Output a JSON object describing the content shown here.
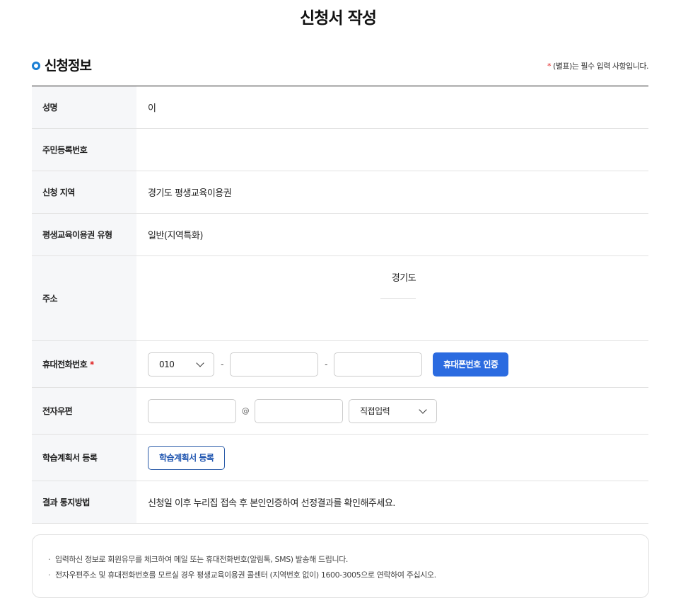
{
  "page_title": "신청서 작성",
  "section": {
    "title": "신청정보",
    "required_star": "*",
    "required_note": "(별표)는 필수 입력 사항입니다."
  },
  "rows": {
    "name": {
      "label": "성명",
      "value": "이"
    },
    "resident_number": {
      "label": "주민등록번호",
      "value": ""
    },
    "region": {
      "label": "신청 지역",
      "value": "경기도 평생교육이용권"
    },
    "voucher_type": {
      "label": "평생교육이용권 유형",
      "value": "일반(지역특화)"
    },
    "address": {
      "label": "주소",
      "line1": "경기도",
      "line2": ""
    },
    "phone": {
      "label": "휴대전화번호",
      "required_star": "*",
      "prefix_selected": "010",
      "separator": "-",
      "middle_value": "",
      "last_value": "",
      "verify_button": "휴대폰번호 인증"
    },
    "email": {
      "label": "전자우편",
      "id_value": "",
      "at_sign": "@",
      "domain_value": "",
      "domain_select": "직접입력"
    },
    "study_plan": {
      "label": "학습계획서 등록",
      "button": "학습계획서 등록"
    },
    "result_notice": {
      "label": "결과 통지방법",
      "value": "신청일 이후 누리집 접속 후 본인인증하여 선정결과를 확인해주세요."
    }
  },
  "notice": {
    "bullet": "·",
    "items": [
      "입력하신 정보로 회원유무를 체크하여 메일 또는 휴대전화번호(알림톡, SMS) 발송해 드립니다.",
      "전자우편주소 및 휴대전화번호를 모르실 경우 평생교육이용권 콜센터 (지역번호 없이) 1600-3005으로 연락하여 주십시오."
    ]
  },
  "colors": {
    "accent": "#2b6be0",
    "section_bullet": "#1a7fd4",
    "required": "#e02020",
    "header_bg": "#f6f7f9"
  }
}
